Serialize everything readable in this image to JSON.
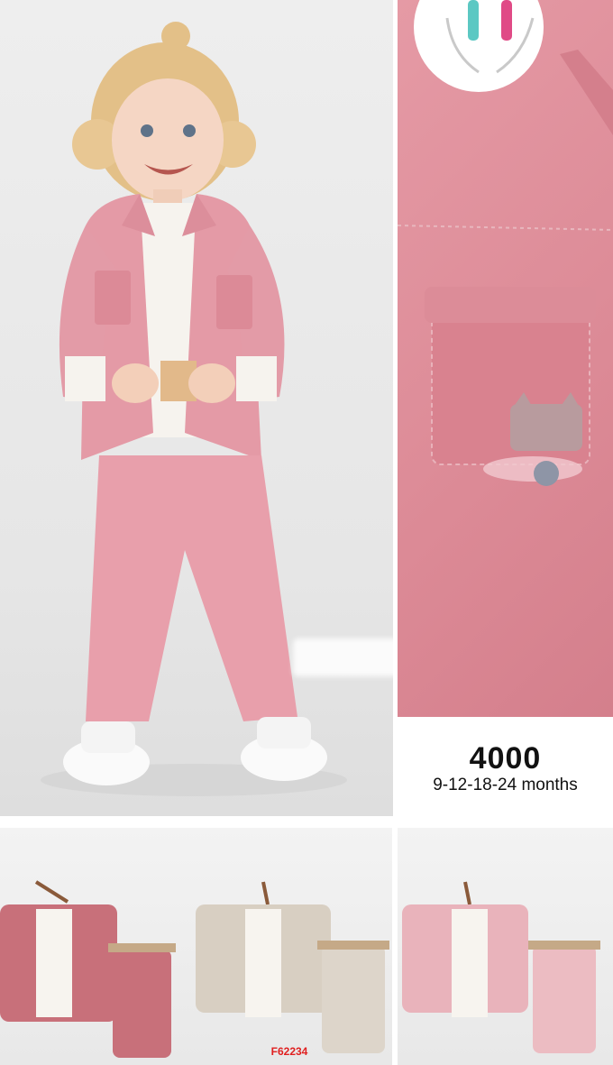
{
  "price": {
    "amount": "4000",
    "sizes": "9-12-18-24 months"
  },
  "product_code": "F62234",
  "colors": {
    "jacket_pink": "#e49aa6",
    "tee_white": "#f6f3ee",
    "variant_rose": "#c8707a",
    "variant_beige": "#d8cfc2",
    "variant_light_pink": "#e9b3bb",
    "code_red": "#e01f1f"
  },
  "photos": [
    {
      "name": "main-photo",
      "subject": "toddler-pink-denim-set"
    },
    {
      "name": "detail-photo",
      "subject": "pocket-cat-applique"
    },
    {
      "name": "variant-rose",
      "subject": "rose-set"
    },
    {
      "name": "variant-beige",
      "subject": "beige-set"
    },
    {
      "name": "variant-pink",
      "subject": "light-pink-set"
    }
  ]
}
